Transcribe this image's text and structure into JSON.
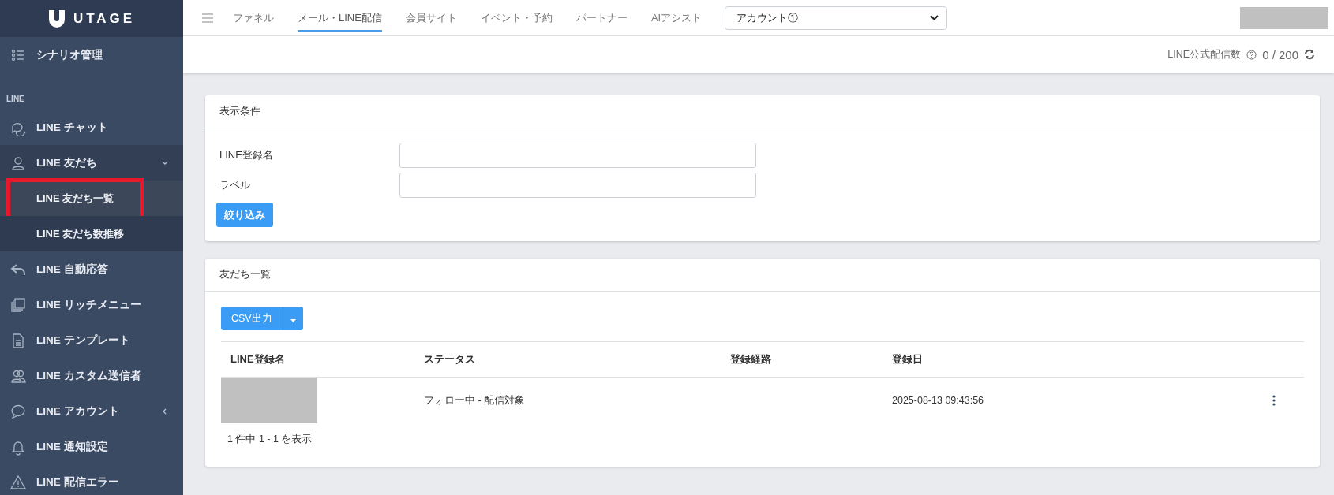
{
  "sidebar": {
    "logo": "UTAGE",
    "entries": [
      {
        "kind": "item",
        "label": "シナリオ管理"
      },
      {
        "kind": "heading",
        "label": "LINE"
      },
      {
        "kind": "item",
        "label": "LINE チャット"
      },
      {
        "kind": "item",
        "label": "LINE 友だち",
        "expanded": true,
        "children": [
          {
            "label": "LINE 友だち一覧",
            "selected": true,
            "highlighted": true
          },
          {
            "label": "LINE 友だち数推移",
            "selected": false,
            "highlighted": false
          }
        ]
      },
      {
        "kind": "item",
        "label": "LINE 自動応答"
      },
      {
        "kind": "item",
        "label": "LINE リッチメニュー"
      },
      {
        "kind": "item",
        "label": "LINE テンプレート"
      },
      {
        "kind": "item",
        "label": "LINE カスタム送信者"
      },
      {
        "kind": "item",
        "label": "LINE アカウント",
        "expanded": false
      },
      {
        "kind": "item",
        "label": "LINE 通知設定"
      },
      {
        "kind": "item",
        "label": "LINE 配信エラー"
      }
    ]
  },
  "top_nav": {
    "tabs": [
      {
        "label": "ファネル",
        "selected": false
      },
      {
        "label": "メール・LINE配信",
        "selected": true
      },
      {
        "label": "会員サイト",
        "selected": false
      },
      {
        "label": "イベント・予約",
        "selected": false
      },
      {
        "label": "パートナー",
        "selected": false
      },
      {
        "label": "AIアシスト",
        "selected": false
      }
    ],
    "account_select": {
      "value": "アカウント①"
    },
    "user_redacted": true
  },
  "stats_bar": {
    "label": "LINE公式配信数",
    "value": "0 / 200"
  },
  "filter_card": {
    "title": "表示条件",
    "fields": [
      {
        "label": "LINE登録名"
      },
      {
        "label": "ラベル"
      }
    ],
    "button": "絞り込み"
  },
  "friends_card": {
    "title": "友だち一覧",
    "export_button": "CSV出力",
    "table": {
      "columns": [
        "LINE登録名",
        "ステータス",
        "登録経路",
        "登録日"
      ],
      "rows": [
        {
          "name_redacted": true,
          "status": "フォロー中 - 配信対象",
          "date": "2025-08-13 09:43:56"
        }
      ]
    },
    "pagination": "1 件中 1 - 1 を表示"
  }
}
